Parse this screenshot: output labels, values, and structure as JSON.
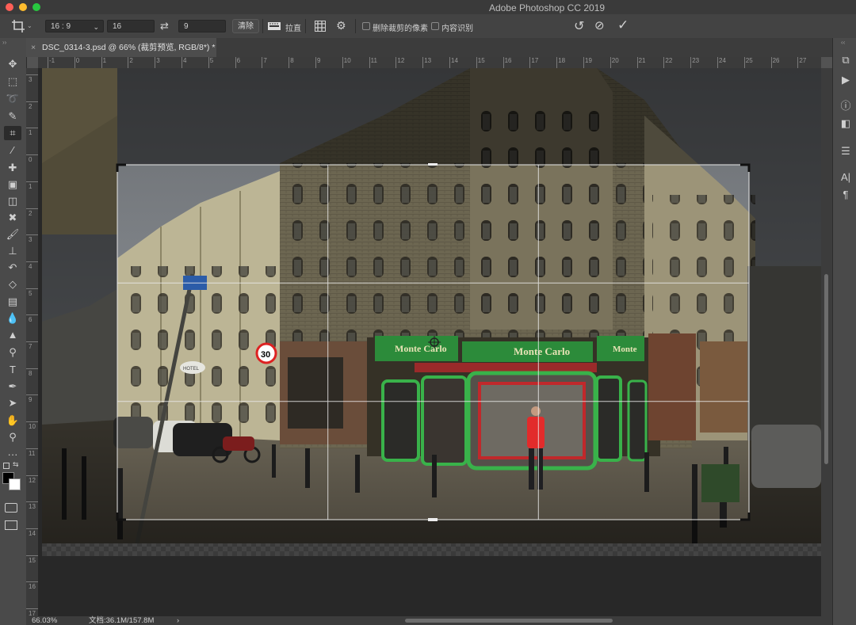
{
  "window": {
    "title": "Adobe Photoshop CC 2019",
    "traffic_colors": [
      "#fe5f57",
      "#febc2e",
      "#28c840"
    ]
  },
  "options_bar": {
    "ratio_preset": "16 : 9",
    "width_value": "16",
    "height_value": "9",
    "clear_label": "清除",
    "straighten_label": "拉直",
    "delete_cropped_label": "删除裁剪的像素",
    "content_aware_label": "内容识别",
    "swap_icon": "⇄",
    "reset_icon": "↺",
    "cancel_icon": "⊘",
    "commit_icon": "✓"
  },
  "document_tab": {
    "label": "DSC_0314-3.psd @ 66% (裁剪预览, RGB/8*) *",
    "close_icon": "×"
  },
  "rulers": {
    "horizontal": [
      "-1",
      "0",
      "1",
      "2",
      "3",
      "4",
      "5",
      "6",
      "7",
      "8",
      "9",
      "10",
      "11",
      "12",
      "13",
      "14",
      "15",
      "16",
      "17",
      "18",
      "19",
      "20",
      "21",
      "22",
      "23",
      "24",
      "25",
      "26",
      "27"
    ],
    "vertical": [
      "3",
      "2",
      "1",
      "0",
      "1",
      "2",
      "3",
      "4",
      "5",
      "6",
      "7",
      "8",
      "9",
      "10",
      "11",
      "12",
      "13",
      "14",
      "15",
      "16",
      "17"
    ]
  },
  "storefront": {
    "sign_left": "Monte Carlo",
    "sign_main": "Monte Carlo",
    "sign_right": "Monte",
    "speed_sign": "30",
    "hotel_sign": "HOTEL"
  },
  "toolbox": [
    {
      "name": "move-tool-icon",
      "glyph": "✥"
    },
    {
      "name": "marquee-tool-icon",
      "glyph": "⬚"
    },
    {
      "name": "lasso-tool-icon",
      "glyph": "➰"
    },
    {
      "name": "quick-select-tool-icon",
      "glyph": "✎"
    },
    {
      "name": "crop-tool-icon",
      "glyph": "⌗"
    },
    {
      "name": "eyedropper-tool-icon",
      "glyph": "⁄"
    },
    {
      "name": "healing-brush-tool-icon",
      "glyph": "✚"
    },
    {
      "name": "patch-tool-icon",
      "glyph": "▣"
    },
    {
      "name": "object-select-tool-icon",
      "glyph": "◫"
    },
    {
      "name": "content-aware-move-tool-icon",
      "glyph": "✖"
    },
    {
      "name": "brush-tool-icon",
      "glyph": "🖌"
    },
    {
      "name": "clone-stamp-tool-icon",
      "glyph": "⊥"
    },
    {
      "name": "history-brush-tool-icon",
      "glyph": "↶"
    },
    {
      "name": "eraser-tool-icon",
      "glyph": "◇"
    },
    {
      "name": "gradient-tool-icon",
      "glyph": "▤"
    },
    {
      "name": "blur-tool-icon",
      "glyph": "💧"
    },
    {
      "name": "sharpen-tool-icon",
      "glyph": "▲"
    },
    {
      "name": "dodge-tool-icon",
      "glyph": "⚲"
    },
    {
      "name": "type-tool-icon",
      "glyph": "T"
    },
    {
      "name": "pen-tool-icon",
      "glyph": "✒"
    },
    {
      "name": "path-select-tool-icon",
      "glyph": "➤"
    },
    {
      "name": "hand-tool-icon",
      "glyph": "✋"
    },
    {
      "name": "zoom-tool-icon",
      "glyph": "⚲"
    },
    {
      "name": "more-tools-icon",
      "glyph": "···"
    }
  ],
  "right_panel_icons": [
    {
      "name": "history-panel-icon",
      "glyph": "⧉"
    },
    {
      "name": "actions-panel-icon",
      "glyph": "▶"
    },
    {
      "name": "info-panel-icon",
      "glyph": "ⓘ"
    },
    {
      "name": "swatches-panel-icon",
      "glyph": "◧"
    },
    {
      "name": "properties-panel-icon",
      "glyph": "☰"
    },
    {
      "name": "character-panel-icon",
      "glyph": "A|"
    },
    {
      "name": "paragraph-panel-icon",
      "glyph": "¶"
    }
  ],
  "status_bar": {
    "zoom": "66.03%",
    "doc_info": "文档:36.1M/157.8M",
    "arrow": "›"
  }
}
